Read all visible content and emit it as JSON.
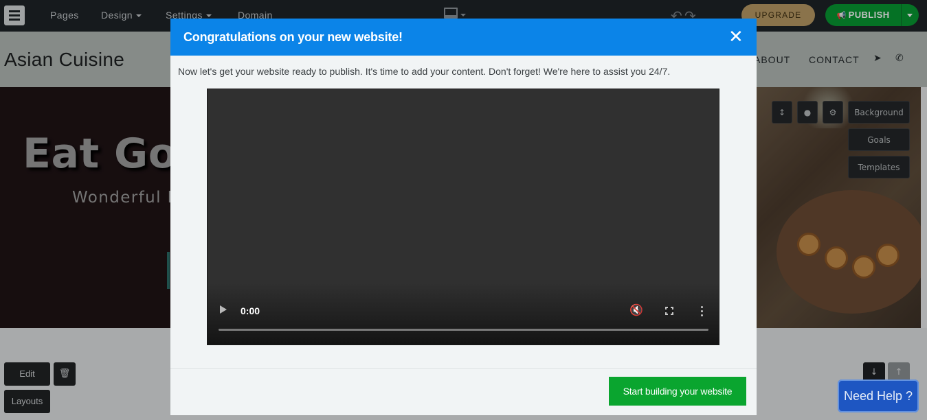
{
  "editor": {
    "nav": [
      "Pages",
      "Design",
      "Settings",
      "Domain"
    ],
    "upgrade_label": "UPGRADE",
    "publish_label": "PUBLISH",
    "colors": {
      "topbar": "#1e2327",
      "upgrade": "#b89a65",
      "publish": "#079832"
    }
  },
  "site": {
    "logo": "Asian Cuisine",
    "nav": {
      "about": "ABOUT",
      "contact": "CONTACT"
    },
    "hero": {
      "title": "Eat Good",
      "subtitle": "Wonderful Food"
    },
    "section_tools": {
      "background": "Background",
      "goals": "Goals",
      "templates": "Templates"
    },
    "block_tools": {
      "edit": "Edit",
      "layouts": "Layouts"
    }
  },
  "help": {
    "label": "Need Help ?"
  },
  "modal": {
    "title": "Congratulations on your new website!",
    "description": "Now let's get your website ready to publish. It's time to add your content. Don't forget! We're here to assist you 24/7.",
    "video": {
      "time": "0:00"
    },
    "cta_label": "Start building your website",
    "colors": {
      "header": "#0b84e8",
      "cta": "#0aa52f"
    }
  },
  "icons": [
    "menu-icon",
    "device-icon",
    "undo-icon",
    "redo-icon",
    "megaphone-icon",
    "location-icon",
    "phone-icon",
    "resize-icon",
    "color-drop-icon",
    "gear-icon",
    "trash-icon",
    "arrow-down-icon",
    "arrow-up-icon",
    "close-icon",
    "play-icon",
    "mute-icon",
    "fullscreen-icon",
    "more-options-icon"
  ]
}
